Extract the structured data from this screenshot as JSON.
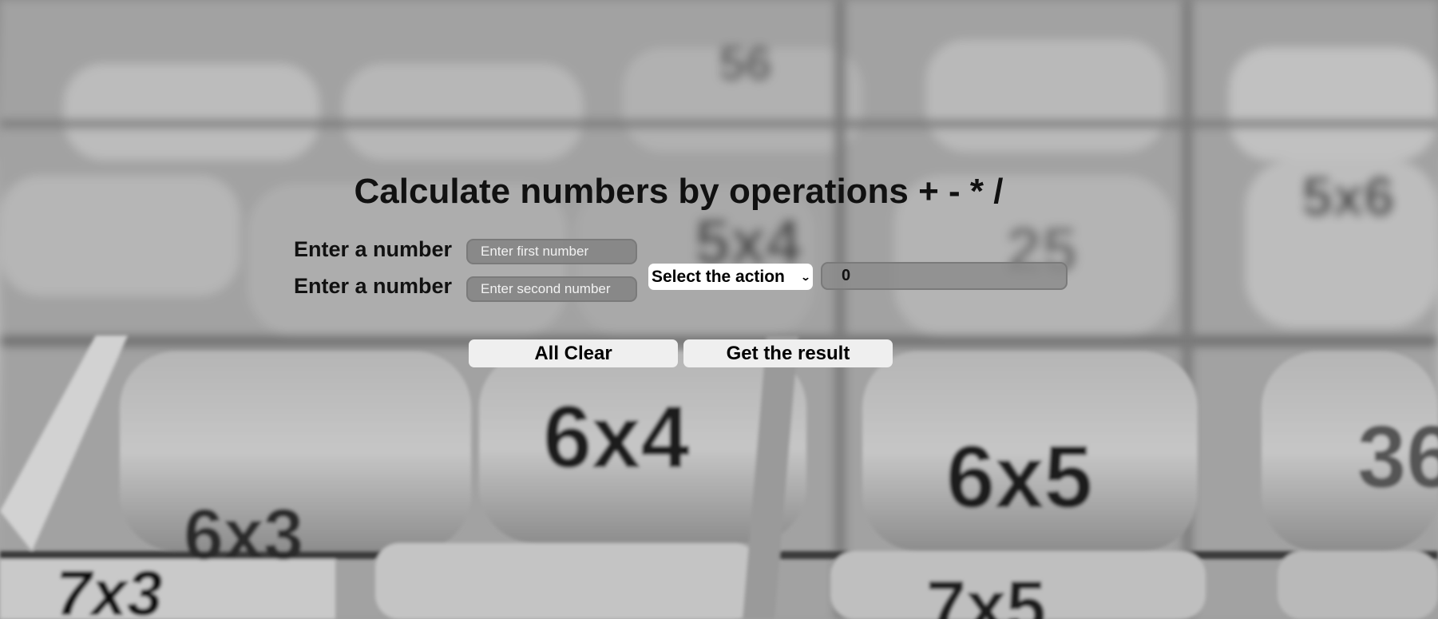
{
  "page": {
    "title": "Calculate numbers by operations + - * /"
  },
  "form": {
    "first_label": "Enter a number",
    "first_placeholder": "Enter first number",
    "second_label": "Enter a number",
    "second_placeholder": "Enter second number",
    "action_select": {
      "selected": "Select the action"
    },
    "result_value": "0"
  },
  "buttons": {
    "clear_label": "All Clear",
    "result_label": "Get the result"
  },
  "background": {
    "style": "grayscale blurred photo of multiplication flashcard rollers",
    "visible_tiles": [
      "6x4",
      "6x5",
      "6x3",
      "7x3",
      "7x5",
      "5x4",
      "25",
      "5x6",
      "36"
    ]
  },
  "colors": {
    "text": "#111111",
    "button_bg": "#efefef",
    "select_bg": "#ffffff",
    "input_bg": "#828282"
  }
}
